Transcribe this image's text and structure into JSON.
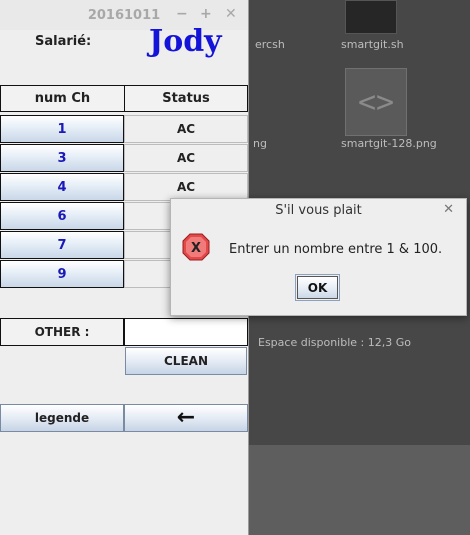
{
  "window": {
    "title": "20161011",
    "minimize_icon": "minimize-icon",
    "maximize_icon": "maximize-icon",
    "close_icon": "close-icon"
  },
  "employee": {
    "label": "Salarié:",
    "name": "Jody"
  },
  "table": {
    "headers": [
      "num Ch",
      "Status"
    ],
    "rows": [
      {
        "num": "1",
        "status": "AC"
      },
      {
        "num": "3",
        "status": "AC"
      },
      {
        "num": "4",
        "status": "AC"
      },
      {
        "num": "6",
        "status": ""
      },
      {
        "num": "7",
        "status": ""
      },
      {
        "num": "9",
        "status": ""
      }
    ]
  },
  "other": {
    "label": "OTHER :",
    "value": ""
  },
  "buttons": {
    "clean": "CLEAN",
    "legend": "legende",
    "back_icon": "left-arrow-icon",
    "back_glyph": "←"
  },
  "dialog": {
    "title": "S'il vous plait",
    "message": "Entrer un nombre entre 1 & 100.",
    "ok_label": "OK",
    "icon": "error-icon"
  },
  "desktop": {
    "files": [
      "smartgit.sh",
      "smartgit-128.png"
    ],
    "partial_labels": [
      "ercsh",
      "ng",
      "Espace disponible : 12,3 Go"
    ]
  }
}
